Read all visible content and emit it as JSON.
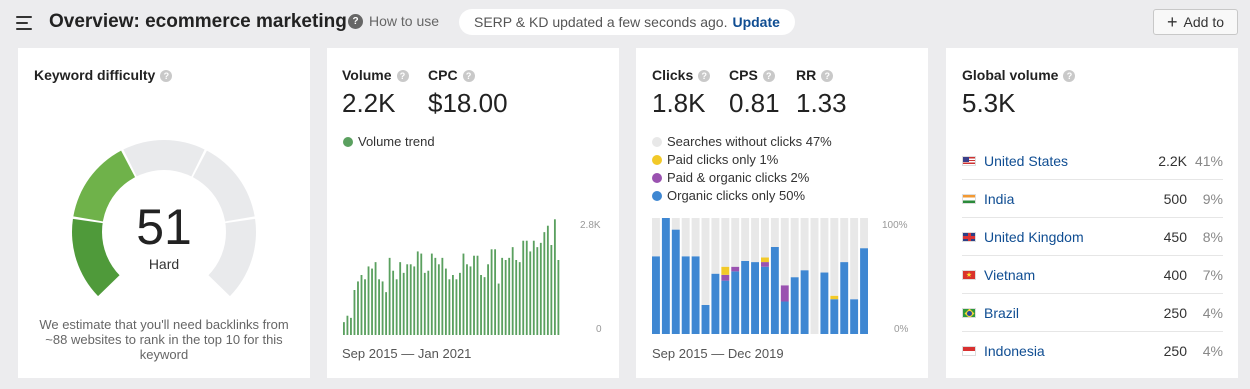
{
  "header": {
    "menu_icon": "menu-icon",
    "title": "Overview: ecommerce marketing",
    "how_to": "How to use",
    "status_text": "SERP & KD updated a few seconds ago.",
    "update_link": "Update",
    "add_button": "Add to"
  },
  "keyword_difficulty": {
    "label": "Keyword difficulty",
    "value": "51",
    "value_fraction": 0.51,
    "level": "Hard",
    "description": "We estimate that you'll need backlinks from ~88 websites to rank in the top 10 for this keyword",
    "colors": {
      "segment_low": "#4f9a3a",
      "segment_mid": "#6fb24a",
      "segment_high": "#c6c52c",
      "empty": "#e9eaec"
    }
  },
  "volume_card": {
    "volume_label": "Volume",
    "volume_value": "2.2K",
    "cpc_label": "CPC",
    "cpc_value": "$18.00",
    "legend": "Volume trend",
    "axis_max": "2.8K",
    "axis_min": "0",
    "date_start": "Sep 2015",
    "date_end": "Jan 2021",
    "date_sep": "—",
    "bar_color": "#5aa05f"
  },
  "clicks_card": {
    "clicks_label": "Clicks",
    "clicks_value": "1.8K",
    "cps_label": "CPS",
    "cps_value": "0.81",
    "rr_label": "RR",
    "rr_value": "1.33",
    "legend": [
      {
        "label": "Searches without clicks 47%",
        "color": "#e8e8e8"
      },
      {
        "label": "Paid clicks only 1%",
        "color": "#f2c928"
      },
      {
        "label": "Paid & organic clicks 2%",
        "color": "#9a52b0"
      },
      {
        "label": "Organic clicks only 50%",
        "color": "#3e87d2"
      }
    ],
    "axis_max": "100%",
    "axis_min": "0%",
    "date_start": "Sep 2015",
    "date_end": "Dec 2019",
    "date_sep": "—"
  },
  "global_volume": {
    "label": "Global volume",
    "value": "5.3K",
    "countries": [
      {
        "name": "United States",
        "volume": "2.2K",
        "percent": "41%",
        "flag": "us-flag"
      },
      {
        "name": "India",
        "volume": "500",
        "percent": "9%",
        "flag": "in-flag"
      },
      {
        "name": "United Kingdom",
        "volume": "450",
        "percent": "8%",
        "flag": "gb-flag"
      },
      {
        "name": "Vietnam",
        "volume": "400",
        "percent": "7%",
        "flag": "vn-flag"
      },
      {
        "name": "Brazil",
        "volume": "250",
        "percent": "4%",
        "flag": "br-flag"
      },
      {
        "name": "Indonesia",
        "volume": "250",
        "percent": "4%",
        "flag": "id-flag"
      }
    ]
  },
  "chart_data": [
    {
      "type": "bar",
      "ylim": [
        0,
        2800
      ],
      "values": [
        300,
        450,
        400,
        1050,
        1250,
        1400,
        1300,
        1600,
        1550,
        1700,
        1300,
        1250,
        1000,
        1800,
        1500,
        1300,
        1700,
        1450,
        1650,
        1650,
        1600,
        1950,
        1900,
        1450,
        1500,
        1900,
        1800,
        1650,
        1800,
        1550,
        1300,
        1400,
        1300,
        1450,
        1900,
        1650,
        1600,
        1850,
        1850,
        1400,
        1350,
        1650,
        2000,
        2000,
        1200,
        1800,
        1750,
        1800,
        2050,
        1750,
        1700,
        2200,
        2200,
        1950,
        2200,
        2050,
        2150,
        2400,
        2550,
        2100,
        2700,
        1750
      ]
    },
    {
      "type": "bar",
      "ylim": [
        0,
        100
      ],
      "series": [
        {
          "name": "Searches without clicks",
          "values": [
            33,
            0,
            10,
            33,
            33,
            75,
            48,
            42,
            42,
            37,
            38,
            34,
            25,
            58,
            51,
            45,
            100,
            47,
            67,
            38,
            70,
            26
          ]
        },
        {
          "name": "Paid clicks only",
          "values": [
            0,
            0,
            0,
            0,
            0,
            0,
            0,
            7,
            0,
            0,
            0,
            4,
            0,
            0,
            0,
            0,
            0,
            0,
            3,
            0,
            0,
            0
          ]
        },
        {
          "name": "Paid & organic clicks",
          "values": [
            0,
            0,
            0,
            0,
            0,
            0,
            0,
            5,
            4,
            0,
            0,
            4,
            0,
            14,
            0,
            0,
            0,
            0,
            0,
            0,
            0,
            0
          ]
        },
        {
          "name": "Organic clicks only",
          "values": [
            67,
            100,
            90,
            67,
            67,
            25,
            52,
            46,
            54,
            63,
            62,
            58,
            75,
            28,
            49,
            55,
            0,
            53,
            30,
            62,
            30,
            74
          ]
        }
      ]
    }
  ]
}
